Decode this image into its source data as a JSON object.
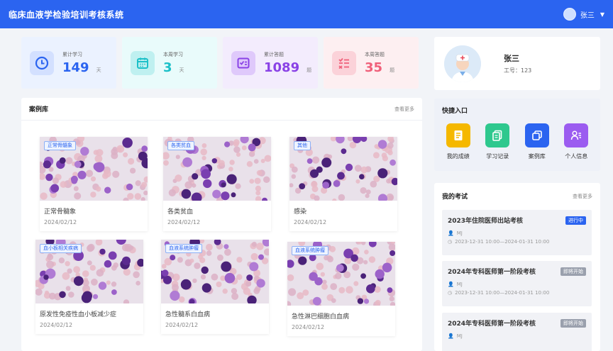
{
  "app": {
    "title": "临床血液学检验培训考核系统"
  },
  "user": {
    "name": "张三"
  },
  "stats": [
    {
      "label": "累计学习",
      "value": "149",
      "unit": "天",
      "color": "#2b64f0",
      "bg": "#ebf2ff",
      "icon_bg": "#d3e0ff",
      "icon": "clock-icon"
    },
    {
      "label": "本周学习",
      "value": "3",
      "unit": "天",
      "color": "#1cc0c8",
      "bg": "#e9fbfb",
      "icon_bg": "#bff0f0",
      "icon": "calendar-icon"
    },
    {
      "label": "累计答题",
      "value": "1089",
      "unit": "题",
      "color": "#8a42e6",
      "bg": "#f3ecfd",
      "icon_bg": "#dfc9fb",
      "icon": "checklist-icon"
    },
    {
      "label": "本周答题",
      "value": "35",
      "unit": "题",
      "color": "#f0607a",
      "bg": "#fdeff1",
      "icon_bg": "#fbd2d9",
      "icon": "task-list-icon"
    }
  ],
  "profile": {
    "name": "张三",
    "job_id": "工号：123"
  },
  "cases": {
    "title": "案例库",
    "more": "查看更多",
    "items": [
      {
        "tag": "正常骨髓象",
        "name": "正常骨髓象",
        "date": "2024/02/12"
      },
      {
        "tag": "各类贫血",
        "name": "各类贫血",
        "date": "2024/02/12"
      },
      {
        "tag": "其他",
        "name": "感染",
        "date": "2024/02/12"
      },
      {
        "tag": "血小板相关疾病",
        "name": "原发性免疫性血小板减少症",
        "date": "2024/02/12"
      },
      {
        "tag": "血液系统肿瘤",
        "name": "急性髓系白血病",
        "date": "2024/02/12"
      },
      {
        "tag": "血液系统肿瘤",
        "name": "急性淋巴细胞白血病",
        "date": "2024/02/12"
      }
    ]
  },
  "quick": {
    "title": "快捷入口",
    "items": [
      {
        "label": "我的成绩",
        "color": "#f5b800",
        "icon": "report-icon"
      },
      {
        "label": "学习记录",
        "color": "#2ec88e",
        "icon": "records-icon"
      },
      {
        "label": "案例库",
        "color": "#2b64f0",
        "icon": "library-icon"
      },
      {
        "label": "个人信息",
        "color": "#9b5cf0",
        "icon": "person-info-icon"
      }
    ]
  },
  "exams": {
    "title": "我的考试",
    "more": "查看更多",
    "items": [
      {
        "title": "2023年住院医师出站考核",
        "status": "进行中",
        "status_color": "#2b64f0",
        "creator": "MJ",
        "time": "2023-12-31 10:00—2024-01-31 10:00"
      },
      {
        "title": "2024年专科医师第一阶段考核",
        "status": "即将开始",
        "status_color": "#9aa0ad",
        "creator": "MJ",
        "time": "2023-12-31 10:00—2024-01-31 10:00"
      },
      {
        "title": "2024年专科医师第一阶段考核",
        "status": "即将开始",
        "status_color": "#9aa0ad",
        "creator": "MJ",
        "time": ""
      }
    ]
  }
}
